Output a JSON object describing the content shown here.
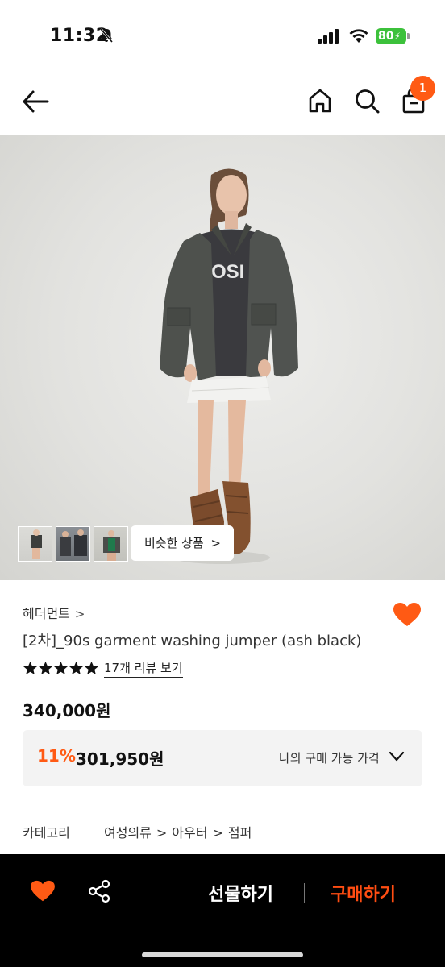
{
  "status_bar": {
    "time": "11:32",
    "battery": "80"
  },
  "nav": {
    "cart_count": "1"
  },
  "gallery": {
    "similar_label": "비슷한 상품",
    "similar_chevron": ">"
  },
  "product": {
    "brand": "헤더먼트",
    "brand_chevron": ">",
    "title": "[2차]_90s garment washing jumper (ash black)",
    "rating_stars": 5,
    "review_link": "17개 리뷰 보기",
    "price": "340,000원",
    "discount_percent": "11%",
    "discount_price": "301,950원",
    "my_price_label": "나의 구매 가능 가격",
    "category_label": "카테고리",
    "category_path": [
      "여성의류",
      "아우터",
      "점퍼"
    ],
    "category_sep": ">"
  },
  "bottom_bar": {
    "gift_label": "선물하기",
    "buy_label": "구매하기"
  },
  "colors": {
    "accent": "#ff5a14",
    "buy": "#ff4d12",
    "heart": "#ff5a14",
    "battery": "#3cc13b"
  },
  "icons": [
    "bell-off-icon",
    "signal-icon",
    "wifi-icon",
    "battery-icon",
    "back-arrow-icon",
    "home-icon",
    "search-icon",
    "cart-icon",
    "chevron-right-icon",
    "heart-icon",
    "star-icon",
    "chevron-down-icon",
    "share-icon"
  ]
}
